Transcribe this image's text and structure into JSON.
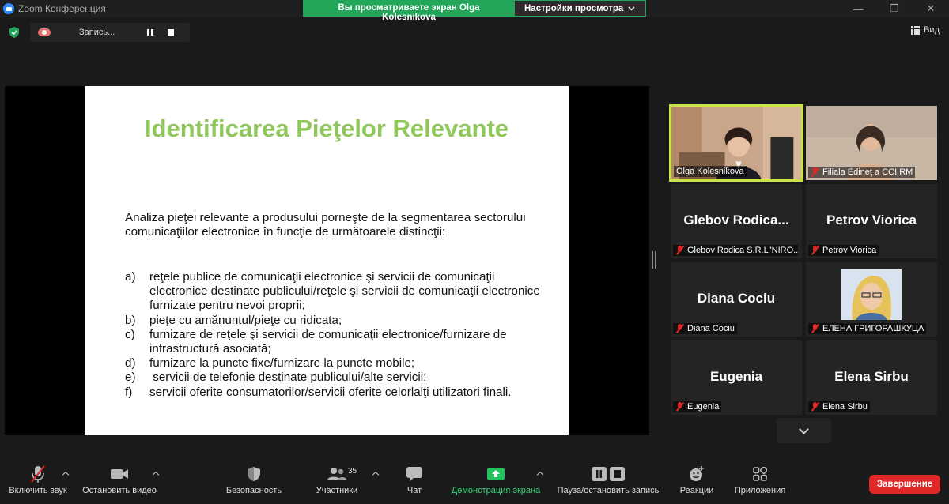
{
  "window": {
    "title": "Zoom Конференция",
    "share_banner": "Вы просматриваете экран Olga Kolesnikova",
    "view_options": "Настройки просмотра",
    "controls": [
      "—",
      "❐",
      "✕"
    ]
  },
  "infobar": {
    "recording_label": "Запись...",
    "view_label": "Вид"
  },
  "slide": {
    "title": "Identificarea Pieţelor Relevante",
    "intro": "Analiza pieţei relevante a produsului porneşte de la segmentarea sectorului comunicaţiilor electronice în funcţie de următoarele distincţii:",
    "items": [
      {
        "marker": "a)",
        "text": "reţele publice de comunicaţii electronice şi servicii de comunicaţii electronice destinate publicului/reţele şi servicii de comunicaţii electronice furnizate pentru nevoi proprii;"
      },
      {
        "marker": "b)",
        "text": "pieţe cu amănuntul/pieţe cu ridicata;"
      },
      {
        "marker": "c)",
        "text": "furnizare de reţele şi servicii de comunicaţii electronice/furnizare de infrastructură asociată;"
      },
      {
        "marker": "d)",
        "text": "furnizare la puncte fixe/furnizare la puncte mobile;"
      },
      {
        "marker": "e)",
        "text": " servicii de telefonie destinate publicului/alte servicii;"
      },
      {
        "marker": "f)",
        "text": "servicii oferite consumatorilor/servicii oferite celorlalţi utilizatori finali."
      }
    ]
  },
  "gallery": [
    {
      "display": "",
      "caption": "Olga Kolesnikova",
      "muted": false,
      "video": "olga",
      "active": true
    },
    {
      "display": "",
      "caption": "Filiala Edineţ a CCI RM",
      "muted": true,
      "video": "filiala",
      "active": false
    },
    {
      "display": "Glebov  Rodica...",
      "caption": "Glebov Rodica S.R.L\"NIRO...",
      "muted": true,
      "video": "",
      "active": false
    },
    {
      "display": "Petrov Viorica",
      "caption": "Petrov Viorica",
      "muted": true,
      "video": "",
      "active": false
    },
    {
      "display": "Diana Cociu",
      "caption": "Diana Cociu",
      "muted": true,
      "video": "",
      "active": false
    },
    {
      "display": "",
      "caption": "ЕЛЕНА ГРИГОРАШКУЦА",
      "muted": true,
      "video": "photo",
      "active": false
    },
    {
      "display": "Eugenia",
      "caption": "Eugenia",
      "muted": true,
      "video": "",
      "active": false
    },
    {
      "display": "Elena Sirbu",
      "caption": "Elena Sirbu",
      "muted": true,
      "video": "",
      "active": false
    }
  ],
  "toolbar": {
    "unmute": "Включить звук",
    "stop_video": "Остановить видео",
    "security": "Безопасность",
    "participants": "Участники",
    "participants_count": "35",
    "chat": "Чат",
    "share_screen": "Демонстрация экрана",
    "pause_record": "Пауза/остановить запись",
    "reactions": "Реакции",
    "apps": "Приложения",
    "end": "Завершение"
  },
  "colors": {
    "slide_title": "#8fc75a",
    "share_banner": "#23a55a",
    "active_speaker": "#c9e44a",
    "end_button": "#e02828"
  }
}
